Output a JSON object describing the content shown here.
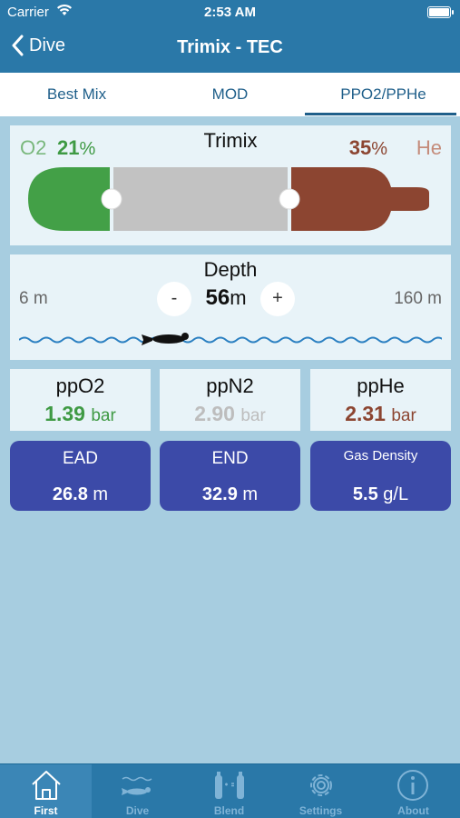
{
  "status": {
    "carrier": "Carrier",
    "time": "2:53 AM"
  },
  "nav": {
    "back_label": "Dive",
    "title": "Trimix - TEC"
  },
  "tabs": [
    {
      "label": "Best Mix"
    },
    {
      "label": "MOD"
    },
    {
      "label": "PPO2/PPHe"
    }
  ],
  "tank": {
    "o2_label": "O2",
    "o2_value": "21",
    "o2_unit": "%",
    "mix_name": "Trimix",
    "he_value": "35",
    "he_unit": "%",
    "he_label": "He",
    "o2_fraction": 0.21,
    "he_fraction": 0.35,
    "colors": {
      "o2": "#43a047",
      "n2": "#c2c2c2",
      "he": "#8c4531"
    }
  },
  "depth": {
    "label": "Depth",
    "min": "6 m",
    "max": "160 m",
    "minus_label": "-",
    "plus_label": "+",
    "value": "56",
    "unit": "m"
  },
  "partial_pressures": [
    {
      "name": "ppO2",
      "value": "1.39",
      "unit": "bar"
    },
    {
      "name": "ppN2",
      "value": "2.90",
      "unit": "bar"
    },
    {
      "name": "ppHe",
      "value": "2.31",
      "unit": "bar"
    }
  ],
  "metrics": [
    {
      "name": "EAD",
      "value": "26.8",
      "unit": "m"
    },
    {
      "name": "END",
      "value": "32.9",
      "unit": "m"
    },
    {
      "name": "Gas Density",
      "value": "5.5",
      "unit": "g/L"
    }
  ],
  "tabbar": [
    {
      "label": "First",
      "icon": "house-icon",
      "active": true
    },
    {
      "label": "Dive",
      "icon": "diver-icon",
      "active": false
    },
    {
      "label": "Blend",
      "icon": "blend-tanks-icon",
      "active": false
    },
    {
      "label": "Settings",
      "icon": "gear-icon",
      "active": false
    },
    {
      "label": "About",
      "icon": "info-icon",
      "active": false
    }
  ]
}
